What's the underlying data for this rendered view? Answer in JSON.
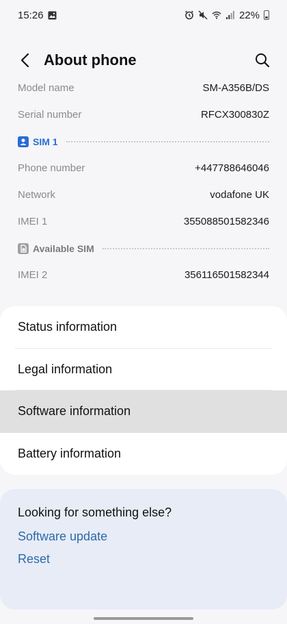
{
  "status_bar": {
    "time": "15:26",
    "battery": "22%"
  },
  "header": {
    "title": "About phone"
  },
  "info": {
    "model_label": "Model name",
    "model_value": "SM-A356B/DS",
    "serial_label": "Serial number",
    "serial_value": "RFCX300830Z",
    "sim1_label": "SIM 1",
    "phone_label": "Phone number",
    "phone_value": "+447788646046",
    "network_label": "Network",
    "network_value": "vodafone UK",
    "imei1_label": "IMEI 1",
    "imei1_value": "355088501582346",
    "available_sim_label": "Available SIM",
    "imei2_label": "IMEI 2",
    "imei2_value": "356116501582344"
  },
  "menu": {
    "items": [
      {
        "label": "Status information"
      },
      {
        "label": "Legal information"
      },
      {
        "label": "Software information"
      },
      {
        "label": "Battery information"
      }
    ]
  },
  "suggest": {
    "title": "Looking for something else?",
    "links": [
      "Software update",
      "Reset"
    ]
  },
  "colors": {
    "accent_link": "#2d6aa6",
    "sim_blue": "#2a6cd6",
    "selected_row": "#e0e0e1"
  }
}
